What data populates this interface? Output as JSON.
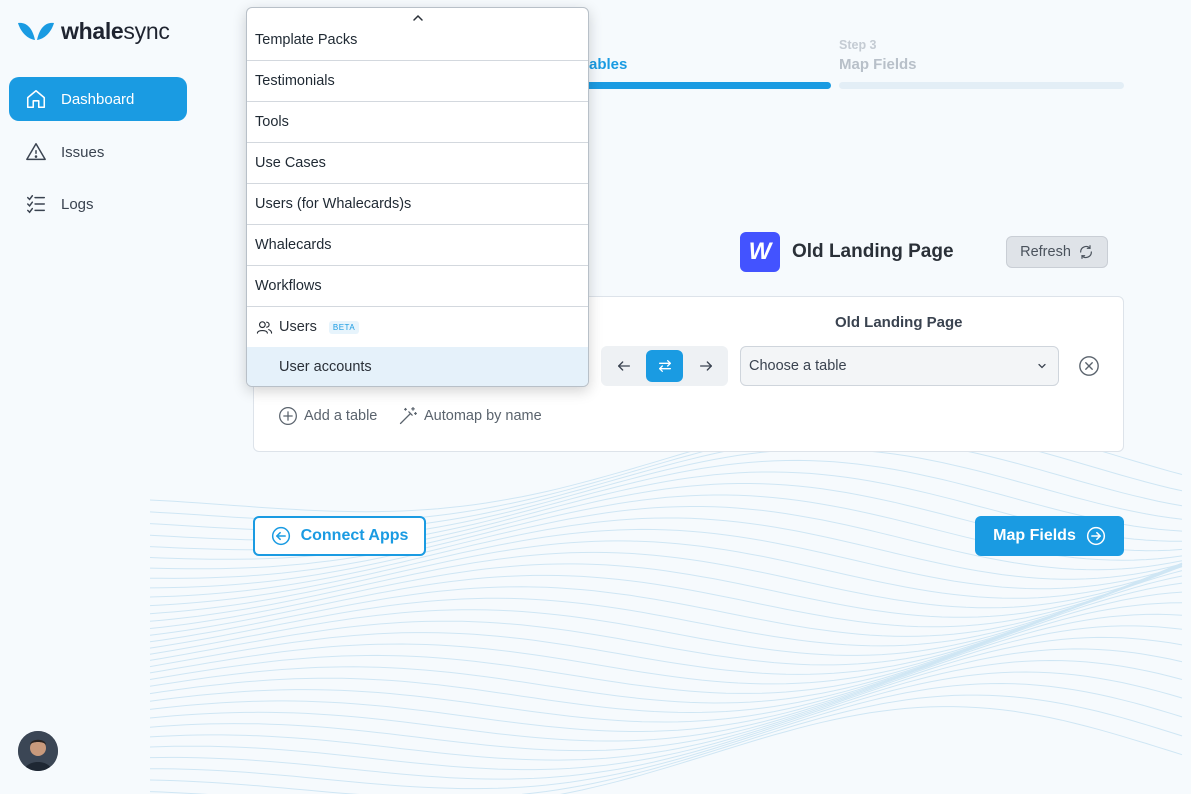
{
  "brand": {
    "name_bold": "whale",
    "name_light": "sync"
  },
  "sidebar": {
    "items": [
      {
        "label": "Dashboard",
        "icon": "home-icon",
        "active": true
      },
      {
        "label": "Issues",
        "icon": "warning-icon",
        "active": false
      },
      {
        "label": "Logs",
        "icon": "checklist-icon",
        "active": false
      }
    ]
  },
  "steps": {
    "step2": {
      "title": "ables"
    },
    "step3": {
      "number": "Step 3",
      "title": "Map Fields"
    }
  },
  "destination_app": {
    "icon_letter": "W",
    "name": "Old Landing Page",
    "refresh_label": "Refresh"
  },
  "mapping": {
    "column_header": "Old Landing Page",
    "select_placeholder": "Choose a table",
    "add_table_label": "Add a table",
    "automap_label": "Automap by name"
  },
  "footer": {
    "back_label": "Connect Apps",
    "next_label": "Map Fields"
  },
  "dropdown": {
    "items": [
      "Template Packs",
      "Testimonials",
      "Tools",
      "Use Cases",
      "Users (for Whalecards)s",
      "Whalecards",
      "Workflows"
    ],
    "group_label": "Users",
    "group_badge": "BETA",
    "group_sub_item": "User accounts"
  },
  "colors": {
    "accent": "#1a9be2",
    "webflow": "#4353ff"
  }
}
